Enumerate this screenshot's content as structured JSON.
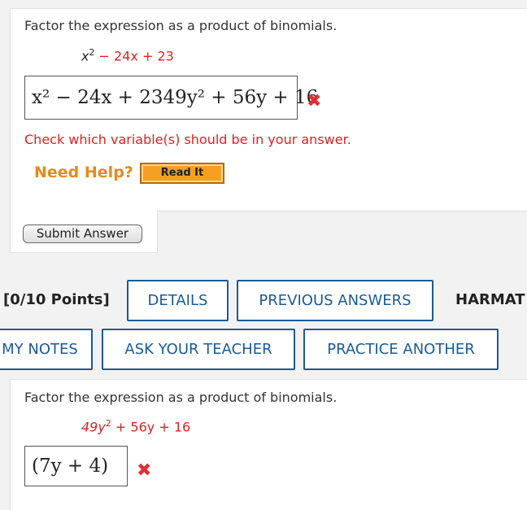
{
  "question1": {
    "prompt": "Factor the expression as a product of binomials.",
    "expr_parts": [
      "x",
      "2",
      " − 24x + 23"
    ],
    "answer": "x² − 24x + 2349y² + 56y + 16",
    "answer_status_icon": "x-mark-icon",
    "hint": "Check which variable(s) should be in your answer.",
    "need_help": "Need Help?",
    "read_it": "Read It",
    "submit": "Submit Answer"
  },
  "question2": {
    "points": "[0/10 Points]",
    "buttons": {
      "details": "DETAILS",
      "previous_answers": "PREVIOUS ANSWERS",
      "source": "HARMAT",
      "my_notes": "MY NOTES",
      "ask_teacher": "ASK YOUR TEACHER",
      "practice_another": "PRACTICE ANOTHER"
    },
    "prompt": "Factor the expression as a product of binomials.",
    "expr_parts": [
      "49y",
      "2",
      " + 56y + 16"
    ],
    "answer": "(7y + 4)",
    "answer_status_icon": "x-mark-icon"
  },
  "colors": {
    "error_red": "#d22222",
    "help_orange": "#e8891b",
    "link_blue": "#1a5b96"
  }
}
